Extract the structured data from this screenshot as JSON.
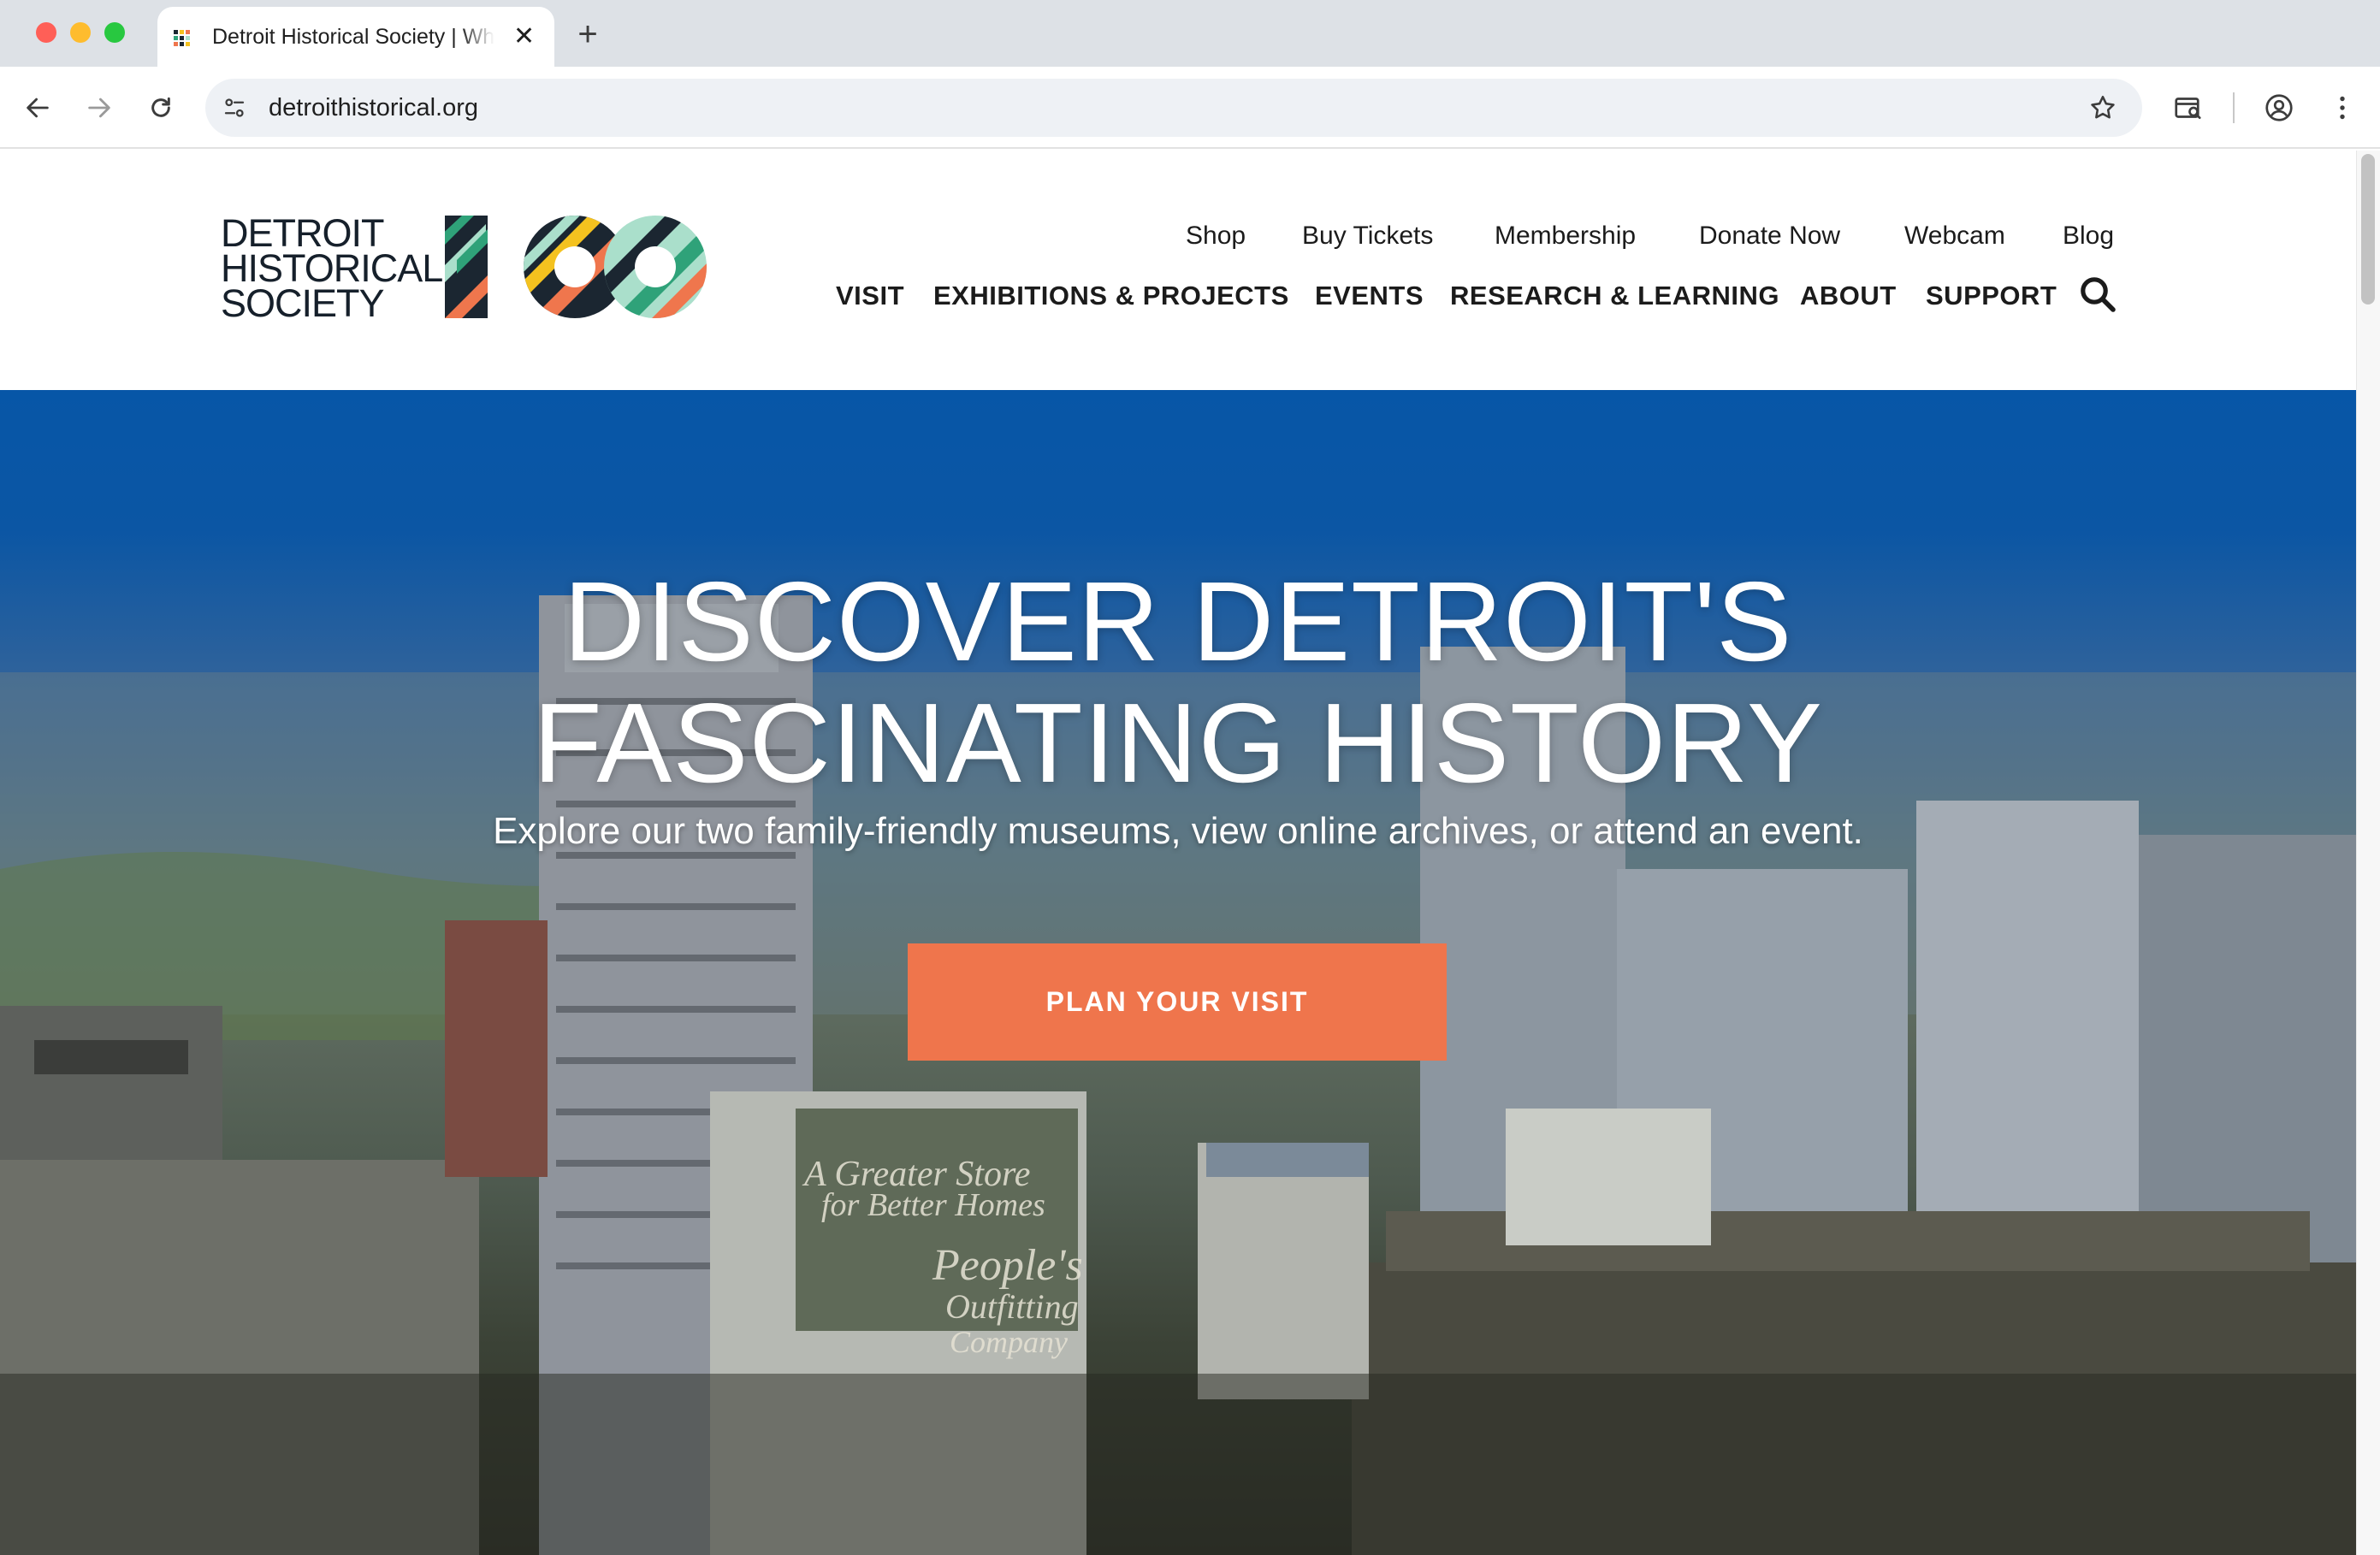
{
  "browser": {
    "tab_title": "Detroit Historical Society | Where the past comes alive",
    "url": "detroithistorical.org",
    "icons": [
      "favicon-icon",
      "close-icon",
      "plus-icon",
      "back-arrow-icon",
      "forward-arrow-icon",
      "reload-icon",
      "site-info-icon",
      "star-icon",
      "tab-search-icon",
      "profile-icon",
      "more-menu-icon"
    ]
  },
  "logo": {
    "line1": "DETROIT",
    "line2": "HISTORICAL",
    "line3": "SOCIETY",
    "mark_colors": [
      "#1b2631",
      "#f4c21f",
      "#ef764d",
      "#2fa279",
      "#aadfcb",
      "#d83a3a"
    ]
  },
  "utility_nav": [
    "Shop",
    "Buy Tickets",
    "Membership",
    "Donate Now",
    "Webcam",
    "Blog"
  ],
  "main_nav": [
    "VISIT",
    "EXHIBITIONS & PROJECTS",
    "EVENTS",
    "RESEARCH & LEARNING",
    "ABOUT",
    "SUPPORT"
  ],
  "hero": {
    "title_line1": "DISCOVER DETROIT'S",
    "title_line2": "FASCINATING HISTORY",
    "subtitle": "Explore our two family-friendly museums, view online archives, or attend an event.",
    "cta_label": "PLAN YOUR VISIT",
    "billboard_line1": "A Greater Store",
    "billboard_line2": "for Better Homes",
    "billboard_line3": "People's",
    "billboard_line4": "Outfitting",
    "billboard_line5": "Company"
  },
  "colors": {
    "hero_blue": "#0756a7",
    "cta_orange": "#ef754c",
    "nav_text": "#1b1b1b"
  }
}
